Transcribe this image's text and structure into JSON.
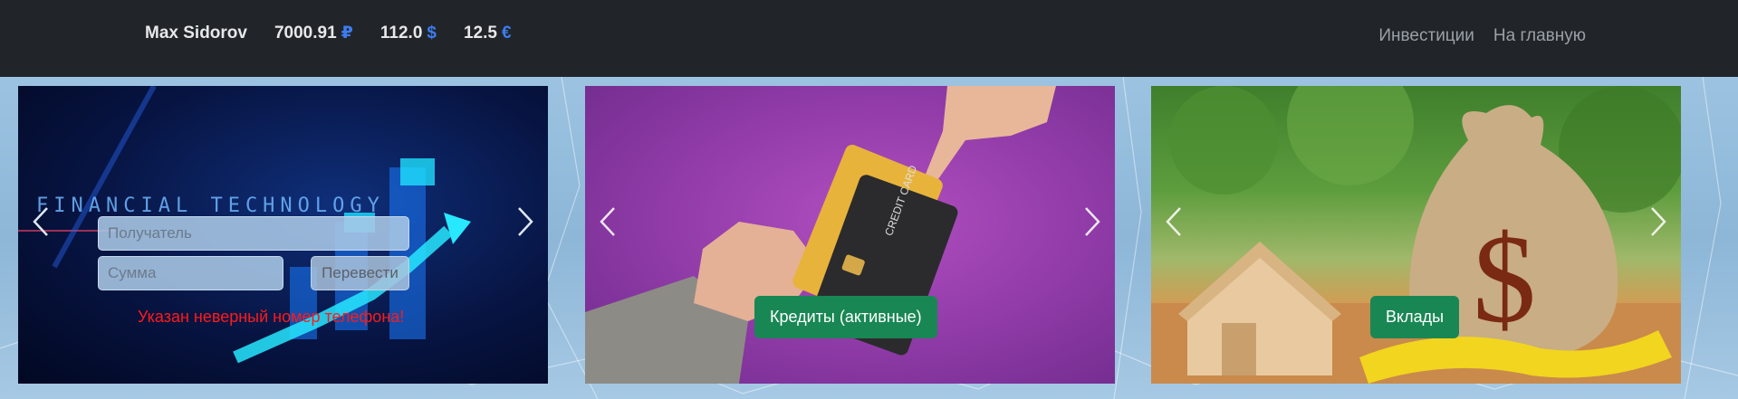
{
  "navbar": {
    "user_name": "Max Sidorov",
    "balances": [
      {
        "amount": "7000.91",
        "currency": "₽"
      },
      {
        "amount": "112.0",
        "currency": "$"
      },
      {
        "amount": "12.5",
        "currency": "€"
      }
    ],
    "links": [
      "Инвестиции",
      "На главную"
    ]
  },
  "transfer": {
    "recipient_placeholder": "Получатель",
    "amount_placeholder": "Сумма",
    "send_label": "Перевести",
    "error_text": "Указан неверный номер телефона!",
    "image_text": "FINANCIAL TECHNOLOGY"
  },
  "credits": {
    "button_label": "Кредиты (активные)",
    "card_text": "CREDIT CARD"
  },
  "deposits": {
    "button_label": "Вклады"
  },
  "colors": {
    "navbar": "#212529",
    "button_green": "#198754",
    "currency_blue": "#3d7cf0",
    "error_red": "#ff1a1a"
  }
}
